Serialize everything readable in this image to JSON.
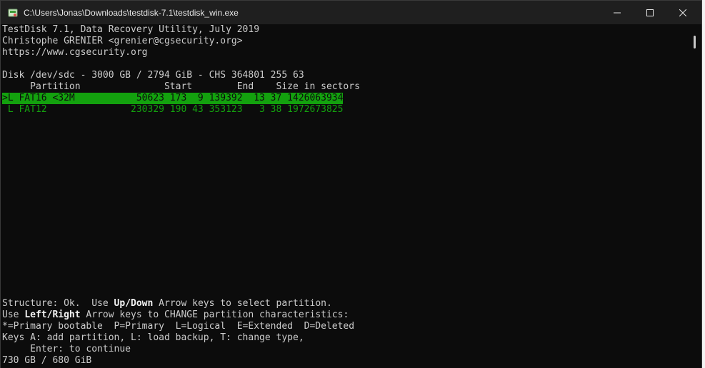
{
  "window": {
    "title": "C:\\Users\\Jonas\\Downloads\\testdisk-7.1\\testdisk_win.exe",
    "icon": "testdisk-app-icon",
    "controls": {
      "minimize": "minimize-icon",
      "maximize": "maximize-icon",
      "close": "close-icon"
    }
  },
  "header": {
    "line1": "TestDisk 7.1, Data Recovery Utility, July 2019",
    "line2": "Christophe GRENIER <grenier@cgsecurity.org>",
    "line3": "https://www.cgsecurity.org"
  },
  "disk": {
    "info": "Disk /dev/sdc - 3000 GB / 2794 GiB - CHS 364801 255 63",
    "columns_header": "     Partition               Start        End    Size in sectors"
  },
  "partitions": [
    {
      "text": ">L FAT16 <32M           50623 173  9 139392  13 37 1426063934",
      "selected": true
    },
    {
      "text": " L FAT12               230329 190 43 353123   3 38 1972673825",
      "selected": false
    }
  ],
  "footer": {
    "structure_pre": "Structure: Ok.  Use ",
    "structure_keys": "Up/Down",
    "structure_post": " Arrow keys to select partition.",
    "use_pre": "Use ",
    "use_keys": "Left/Right",
    "use_post": " Arrow keys to CHANGE partition characteristics:",
    "legend": "*=Primary bootable  P=Primary  L=Logical  E=Extended  D=Deleted",
    "keys": "Keys A: add partition, L: load backup, T: change type,",
    "enter": "     Enter: to continue",
    "size": "730 GB / 680 GiB"
  },
  "colors": {
    "background": "#0c0c0c",
    "text": "#cccccc",
    "highlight": "#13a10e",
    "bold_text": "#f2f2f2",
    "titlebar": "#1f1f1f"
  }
}
